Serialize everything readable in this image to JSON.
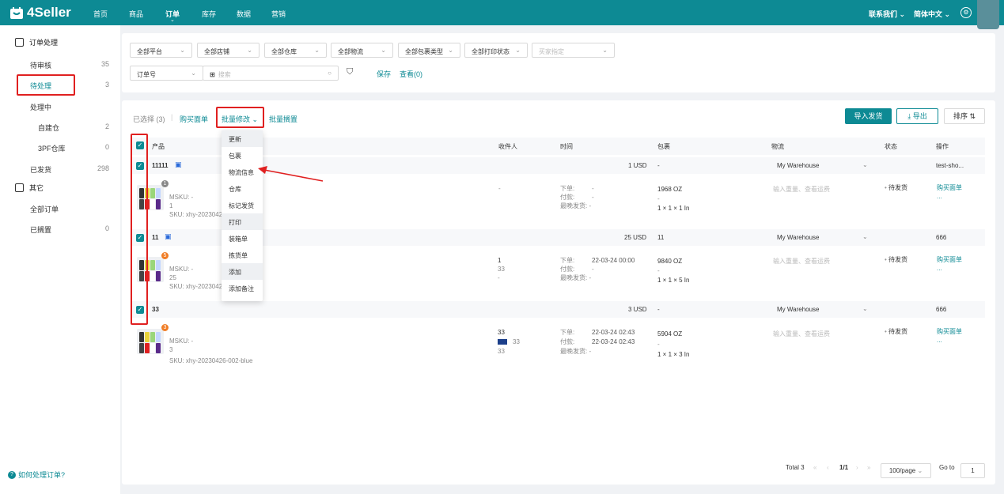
{
  "header": {
    "logo": "4Seller",
    "nav": [
      "首页",
      "商品",
      "订单",
      "库存",
      "数据",
      "营销"
    ],
    "contact": "联系我们",
    "lang": "简体中文"
  },
  "sidebar": {
    "sec1": "订单处理",
    "sec2": "其它",
    "items": [
      {
        "label": "待审核",
        "count": "35"
      },
      {
        "label": "待处理",
        "count": "3"
      },
      {
        "label": "处理中",
        "count": ""
      },
      {
        "label": "自建仓",
        "count": "2"
      },
      {
        "label": "3PF仓库",
        "count": "0"
      },
      {
        "label": "已发货",
        "count": "298"
      },
      {
        "label": "全部订单",
        "count": ""
      },
      {
        "label": "已搁置",
        "count": "0"
      }
    ],
    "help": "如何处理订单?"
  },
  "filters": {
    "platform": "全部平台",
    "store": "全部店铺",
    "warehouse": "全部仓库",
    "logistics": "全部物流",
    "pkg_type": "全部包裹类型",
    "print_status": "全部打印状态",
    "buyer_placeholder": "买家指定",
    "search_type": "订单号",
    "search_placeholder": "搜索",
    "save": "保存",
    "view": "查看(0)"
  },
  "toolbar": {
    "selected": "已选择 (3)",
    "buy_label": "购买面单",
    "batch_modify": "批量修改",
    "batch_shelve": "批量搁置",
    "import": "导入发货",
    "export": "导出",
    "sort": "排序"
  },
  "columns": [
    "产品",
    "收件人",
    "时间",
    "包裹",
    "物流",
    "状态",
    "操作"
  ],
  "menu": [
    "更新",
    "包裹",
    "物流信息",
    "仓库",
    "标记发货",
    "打印",
    "装箱单",
    "拣货单",
    "添加",
    "添加备注"
  ],
  "orders": [
    {
      "id": "11111",
      "amount": "1 USD",
      "pkg_head": "-",
      "warehouse": "My Warehouse",
      "op": "test-sho...",
      "msku": "MSKU: -",
      "qty": "1",
      "sku": "SKU: xhy-2023042",
      "recipient": [
        "-"
      ],
      "t_order": "下单:",
      "t_order_v": "-",
      "t_pay": "付款:",
      "t_pay_v": "-",
      "t_ship": "最晚发货: -",
      "weight": "1968 OZ",
      "dash": "-",
      "dims": "1 × 1 × 1 In",
      "logi_hint": "输入重量、查看运费",
      "status": "待发货",
      "buy": "购买面单",
      "more": "...",
      "badge": "1",
      "badge_color": "#888"
    },
    {
      "id": "11",
      "amount": "25 USD",
      "pkg_head": "11",
      "warehouse": "My Warehouse",
      "op": "666",
      "msku": "MSKU: -",
      "qty": "25",
      "sku": "SKU: xhy-2023042",
      "recipient": [
        "1",
        "33",
        "-"
      ],
      "t_order": "下单:",
      "t_order_v": "22-03-24 00:00",
      "t_pay": "付款:",
      "t_pay_v": "-",
      "t_ship": "最晚发货: -",
      "weight": "9840 OZ",
      "dash": "-",
      "dims": "1 × 1 × 5 In",
      "logi_hint": "输入重量、查看运费",
      "status": "待发货",
      "buy": "购买面单",
      "more": "...",
      "badge": "5",
      "badge_color": "#f07c24"
    },
    {
      "id": "33",
      "amount": "3 USD",
      "pkg_head": "-",
      "warehouse": "My Warehouse",
      "op": "666",
      "msku": "MSKU: -",
      "qty": "3",
      "sku": "SKU: xhy-20230426-002-blue",
      "recipient": [
        "33",
        "33",
        "33"
      ],
      "t_order": "下单:",
      "t_order_v": "22-03-24 02:43",
      "t_pay": "付款:",
      "t_pay_v": "22-03-24 02:43",
      "t_ship": "最晚发货: -",
      "weight": "5904 OZ",
      "dash": "-",
      "dims": "1 × 1 × 3 In",
      "logi_hint": "输入重量、查看运费",
      "status": "待发货",
      "buy": "购买面单",
      "more": "...",
      "badge": "3",
      "badge_color": "#f07c24"
    }
  ],
  "pager": {
    "total": "Total 3",
    "page": "1/1",
    "size": "100/page",
    "goto": "Go to",
    "goto_val": "1"
  }
}
